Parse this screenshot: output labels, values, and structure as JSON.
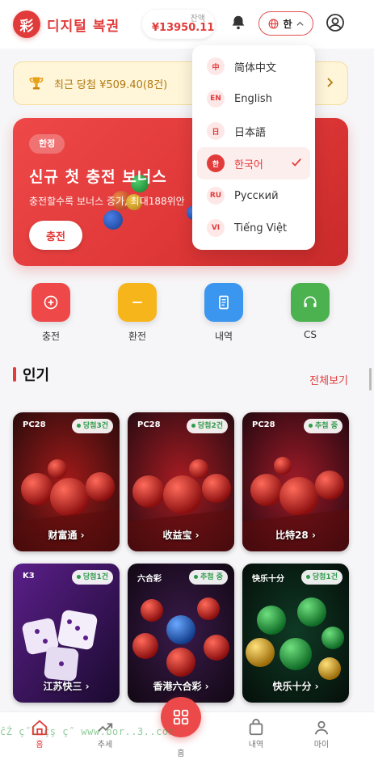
{
  "header": {
    "app_title": "디지털 복권",
    "logo_char": "彩",
    "balance_label": "잔액",
    "balance_value": "¥13950.11",
    "lang_label": "한"
  },
  "win_banner": {
    "text": "최근 당첨 ¥509.40(8건)"
  },
  "hero": {
    "tag": "한정",
    "title": "신규 첫 충전 보너스",
    "subtitle": "충전할수록 보너스 증가, 최대188위안",
    "button": "충전"
  },
  "quick_actions": [
    {
      "label": "충전",
      "icon": "plus-icon",
      "color": "#ee4848"
    },
    {
      "label": "환전",
      "icon": "minus-icon",
      "color": "#f7b51c"
    },
    {
      "label": "내역",
      "icon": "document-icon",
      "color": "#3b96f0"
    },
    {
      "label": "CS",
      "icon": "headset-icon",
      "color": "#4cb14f"
    }
  ],
  "popular": {
    "title": "인기",
    "see_all": "전체보기",
    "games": [
      {
        "type": "PC28",
        "badge": "당첨3건",
        "name": "财富通 ›"
      },
      {
        "type": "PC28",
        "badge": "당첨2건",
        "name": "收益宝 ›"
      },
      {
        "type": "PC28",
        "badge": "추첨 중",
        "name": "比特28 ›"
      },
      {
        "type": "K3",
        "badge": "당첨1건",
        "name": "江苏快三 ›"
      },
      {
        "type": "六合彩",
        "badge": "추첨 중",
        "name": "香港六合彩 ›"
      },
      {
        "type": "快乐十分",
        "badge": "당첨1건",
        "name": "快乐十分 ›"
      }
    ]
  },
  "language_menu": {
    "items": [
      {
        "code": "中",
        "label": "简体中文",
        "selected": false
      },
      {
        "code": "EN",
        "label": "English",
        "selected": false
      },
      {
        "code": "日",
        "label": "日本語",
        "selected": false
      },
      {
        "code": "한",
        "label": "한국어",
        "selected": true
      },
      {
        "code": "RU",
        "label": "Русский",
        "selected": false
      },
      {
        "code": "VI",
        "label": "Tiếng Việt",
        "selected": false
      }
    ]
  },
  "bottom_nav": {
    "items": [
      {
        "label": "홈",
        "icon": "home-icon",
        "active": true
      },
      {
        "label": "추세",
        "icon": "trend-icon",
        "active": false
      },
      {
        "label": "홈",
        "icon": "grid-icon",
        "active": false
      },
      {
        "label": "내역",
        "icon": "bag-icon",
        "active": false
      },
      {
        "label": "마이",
        "icon": "user-icon",
        "active": false
      }
    ]
  },
  "watermark": "ĉŹ ç˝ĺ çş ç˝ www.bor..3..com",
  "colors": {
    "primary": "#e23b3b",
    "gold": "#b17a12",
    "success": "#2e9b4a"
  }
}
